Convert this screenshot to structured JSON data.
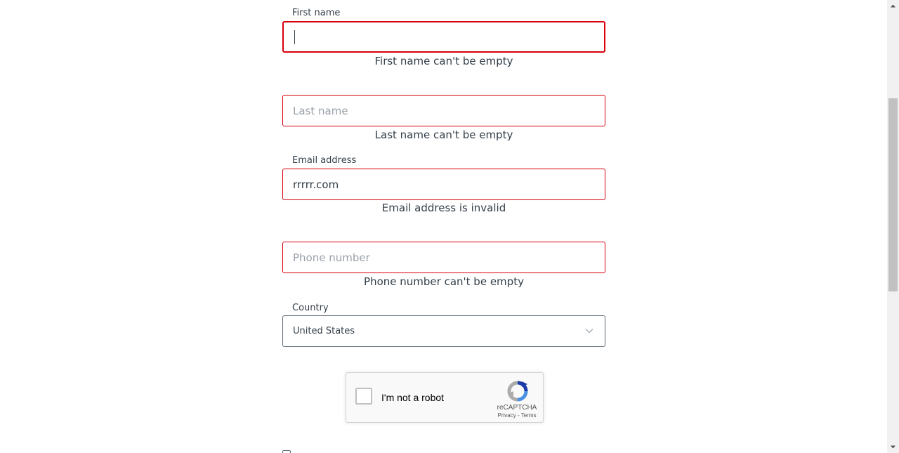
{
  "form": {
    "first_name": {
      "label": "First name",
      "value": "",
      "placeholder": "",
      "error": "First name can't be empty"
    },
    "last_name": {
      "label": "",
      "value": "",
      "placeholder": "Last name",
      "error": "Last name can't be empty"
    },
    "email": {
      "label": "Email address",
      "value": "rrrrr.com",
      "placeholder": "",
      "error": "Email address is invalid"
    },
    "phone": {
      "label": "",
      "value": "",
      "placeholder": "Phone number",
      "error": "Phone number can't be empty"
    },
    "country": {
      "label": "Country",
      "selected": "United States"
    }
  },
  "recaptcha": {
    "label": "I'm not a robot",
    "brand": "reCAPTCHA",
    "privacy": "Privacy",
    "separator": " - ",
    "terms": "Terms"
  },
  "colors": {
    "error_border": "#d8000c",
    "text": "#333e48",
    "placeholder": "#9aa1a8",
    "select_border": "#5f6b76"
  }
}
